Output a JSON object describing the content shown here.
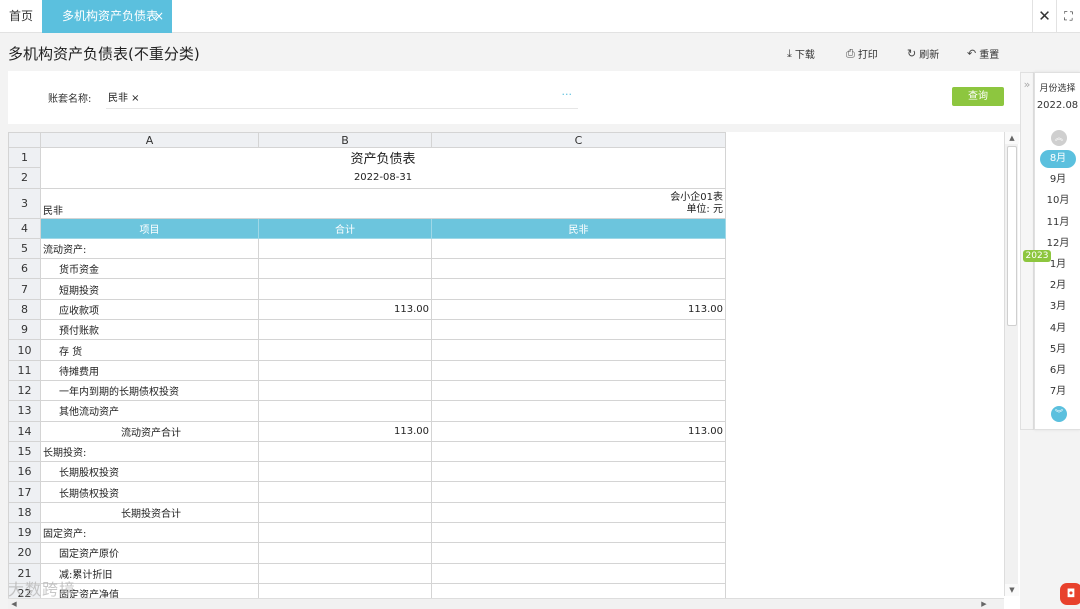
{
  "tabs": {
    "home": "首页",
    "active": "多机构资产负债表",
    "close_mark": "×"
  },
  "window": {
    "close_glyph": "✕",
    "fullscreen_glyph": "⛶"
  },
  "page": {
    "title": "多机构资产负债表(不重分类)"
  },
  "toolbar": {
    "download": "下载",
    "print": "打印",
    "refresh": "刷新",
    "reset": "重置"
  },
  "filter": {
    "label": "账套名称:",
    "tag": "民非 ×",
    "more": "···",
    "query": "查询"
  },
  "sheet": {
    "columns": [
      "A",
      "B",
      "C"
    ],
    "title": "资产负债表",
    "date": "2022-08-31",
    "org": "民非",
    "form_code": "会小企01表",
    "unit": "单位: 元",
    "headers": [
      "项目",
      "合计",
      "民非"
    ],
    "rows": [
      {
        "n": "5",
        "item": "流动资产:",
        "total": "",
        "org": ""
      },
      {
        "n": "6",
        "item": "货币资金",
        "total": "",
        "org": ""
      },
      {
        "n": "7",
        "item": "短期投资",
        "total": "",
        "org": ""
      },
      {
        "n": "8",
        "item": "应收款项",
        "total": "113.00",
        "org": "113.00"
      },
      {
        "n": "9",
        "item": "预付账款",
        "total": "",
        "org": ""
      },
      {
        "n": "10",
        "item": "存  货",
        "total": "",
        "org": ""
      },
      {
        "n": "11",
        "item": "待摊费用",
        "total": "",
        "org": ""
      },
      {
        "n": "12",
        "item": "一年内到期的长期债权投资",
        "total": "",
        "org": ""
      },
      {
        "n": "13",
        "item": "其他流动资产",
        "total": "",
        "org": ""
      },
      {
        "n": "14",
        "item": "流动资产合计",
        "total": "113.00",
        "org": "113.00"
      },
      {
        "n": "15",
        "item": "长期投资:",
        "total": "",
        "org": ""
      },
      {
        "n": "16",
        "item": "长期股权投资",
        "total": "",
        "org": ""
      },
      {
        "n": "17",
        "item": "长期债权投资",
        "total": "",
        "org": ""
      },
      {
        "n": "18",
        "item": "长期投资合计",
        "total": "",
        "org": ""
      },
      {
        "n": "19",
        "item": "固定资产:",
        "total": "",
        "org": ""
      },
      {
        "n": "20",
        "item": "固定资产原价",
        "total": "",
        "org": ""
      },
      {
        "n": "21",
        "item": "减:累计折旧",
        "total": "",
        "org": ""
      },
      {
        "n": "22",
        "item": "固定资产净值",
        "total": "",
        "org": ""
      }
    ],
    "row_numbers_top": [
      "1",
      "2",
      "3",
      "4"
    ]
  },
  "months": {
    "header": "月份选择",
    "current": "2022.08",
    "year_badge": "2023",
    "list": [
      "8月",
      "9月",
      "10月",
      "11月",
      "12月",
      "1月",
      "2月",
      "3月",
      "4月",
      "5月",
      "6月",
      "7月"
    ]
  },
  "watermark": "大数跨境"
}
